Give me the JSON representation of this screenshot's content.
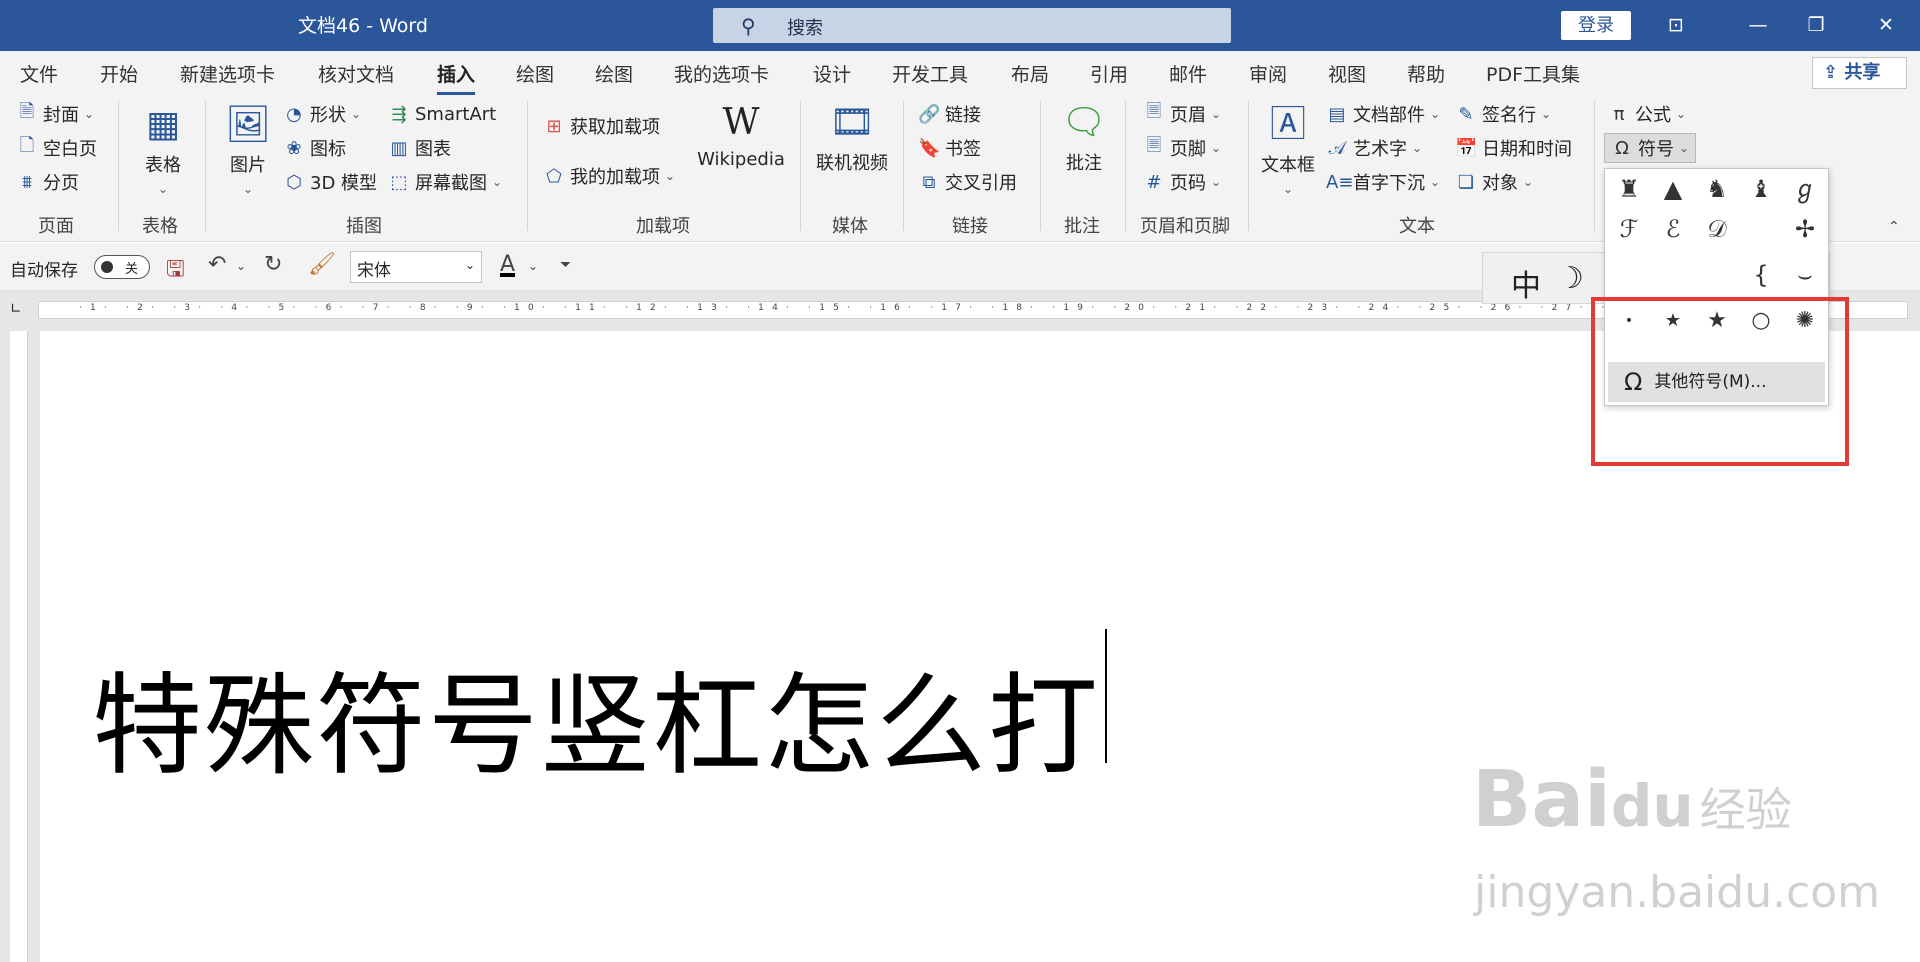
{
  "window": {
    "title": "文档46 - Word",
    "search_placeholder": "搜索",
    "login_label": "登录"
  },
  "tabs": [
    "文件",
    "开始",
    "新建选项卡",
    "核对文档",
    "插入",
    "绘图",
    "绘图",
    "我的选项卡",
    "设计",
    "开发工具",
    "布局",
    "引用",
    "邮件",
    "审阅",
    "视图",
    "帮助",
    "PDF工具集"
  ],
  "active_tab": "插入",
  "share_label": "共享",
  "ribbon": {
    "pages": {
      "cover": "封面",
      "blank": "空白页",
      "break": "分页",
      "group": "页面"
    },
    "tables": {
      "table": "表格",
      "group": "表格"
    },
    "illustrations": {
      "picture": "图片",
      "shapes": "形状",
      "icons": "图标",
      "model3d": "3D 模型",
      "smartart": "SmartArt",
      "chart": "图表",
      "screenshot": "屏幕截图",
      "group": "插图"
    },
    "addins": {
      "get": "获取加载项",
      "my": "我的加载项",
      "wikipedia": "Wikipedia",
      "group": "加载项"
    },
    "media": {
      "video": "联机视频",
      "group": "媒体"
    },
    "links": {
      "link": "链接",
      "bookmark": "书签",
      "crossref": "交叉引用",
      "group": "链接"
    },
    "comments": {
      "comment": "批注",
      "group": "批注"
    },
    "headerfooter": {
      "header": "页眉",
      "footer": "页脚",
      "pagenum": "页码",
      "group": "页眉和页脚"
    },
    "text": {
      "textbox": "文本框",
      "quickparts": "文档部件",
      "wordart": "艺术字",
      "dropcap": "首字下沉",
      "signature": "签名行",
      "datetime": "日期和时间",
      "object": "对象",
      "group": "文本"
    },
    "symbols": {
      "equation": "公式",
      "symbol": "符号"
    }
  },
  "qat": {
    "autosave": "自动保存",
    "toggle_state": "关",
    "font_name": "宋体"
  },
  "mini_toolbar": [
    "中",
    "☽",
    "°,",
    "⚙"
  ],
  "symbol_dropdown": {
    "row1": [
      "♜",
      "▲",
      "♞",
      "♝",
      "ℊ"
    ],
    "row2": [
      "ℱ",
      "ℰ",
      "𝒟",
      "",
      "✢"
    ],
    "row3": [
      "",
      "",
      "",
      "{",
      "⌣"
    ],
    "row4": [
      "•",
      "★",
      "★",
      "○",
      "✺"
    ],
    "more_label": "其他符号(M)..."
  },
  "document": {
    "text": "特殊符号竖杠怎么打"
  },
  "ruler_numbers": "·1· ·2· ·3· ·4· ·5· ·6· ·7· ·8· ·9· ·10· ·11· ·12· ·13· ·14· ·15· ·16· ·17· ·18· ·19· ·20· ·21· ·22· ·23· ·24· ·25· ·26· ·27· ·28· ·29· ·30",
  "watermark": {
    "brand": "Bai",
    "brand2": "du",
    "cn": "经验",
    "url": "jingyan.baidu.com"
  },
  "colors": {
    "accent": "#2b579a",
    "highlight_box": "#e53935"
  }
}
